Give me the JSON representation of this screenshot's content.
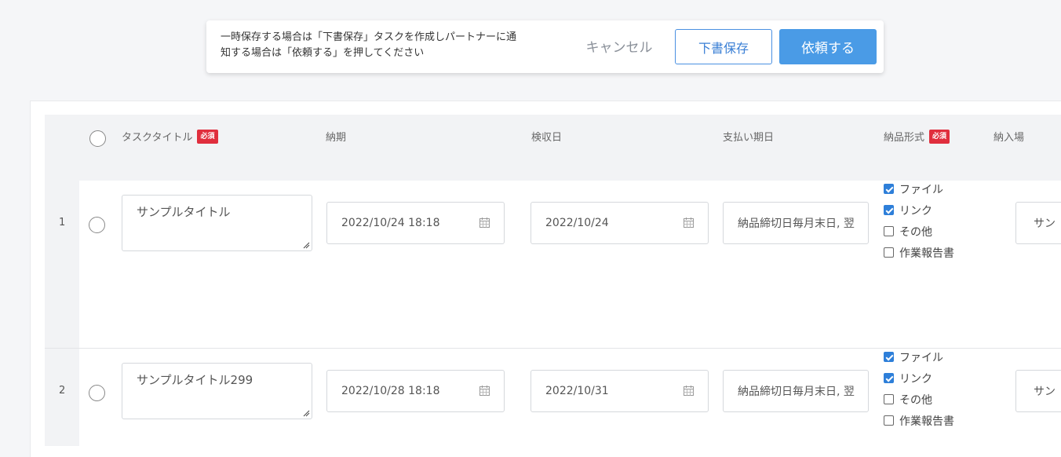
{
  "action_bar": {
    "message_line1": "一時保存する場合は「下書保存」タスクを作成しパートナーに通",
    "message_line2": "知する場合は「依頼する」を押してください",
    "cancel_label": "キャンセル",
    "draft_label": "下書保存",
    "request_label": "依頼する"
  },
  "table": {
    "headers": {
      "task_title": "タスクタイトル",
      "due": "納期",
      "inspection": "検収日",
      "payment": "支払い期日",
      "delivery_format": "納品形式",
      "delivery_place": "納入場"
    },
    "required_badge": "必須",
    "rows": [
      {
        "num": "1",
        "title": "サンプルタイトル",
        "due": "2022/10/24 18:18",
        "inspection": "2022/10/24",
        "payment": "納品締切日毎月末日, 翌",
        "formats": [
          {
            "label": "ファイル",
            "checked": true
          },
          {
            "label": "リンク",
            "checked": true
          },
          {
            "label": "その他",
            "checked": false
          },
          {
            "label": "作業報告書",
            "checked": false
          }
        ],
        "place": "サン"
      },
      {
        "num": "2",
        "title": "サンプルタイトル299",
        "due": "2022/10/28 18:18",
        "inspection": "2022/10/31",
        "payment": "納品締切日毎月末日, 翌",
        "formats": [
          {
            "label": "ファイル",
            "checked": true
          },
          {
            "label": "リンク",
            "checked": true
          },
          {
            "label": "その他",
            "checked": false
          },
          {
            "label": "作業報告書",
            "checked": false
          }
        ],
        "place": "サン"
      }
    ]
  },
  "icons": {
    "calendar": "calendar-icon",
    "resize": "resize-handle-icon"
  },
  "colors": {
    "primary": "#4a9be6",
    "required": "#e02e3d",
    "checkbox_on": "#2e7fd9"
  }
}
